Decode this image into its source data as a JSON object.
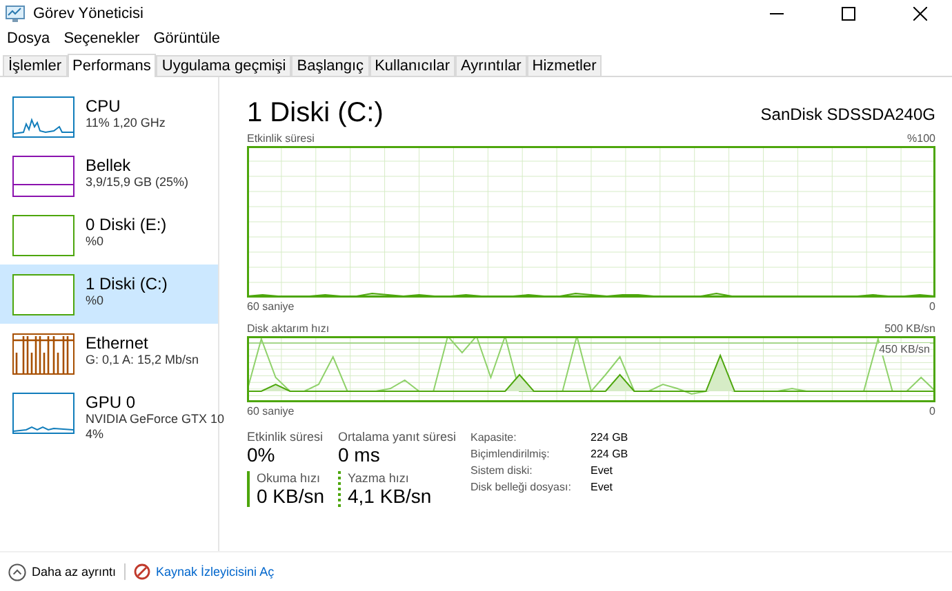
{
  "window": {
    "title": "Görev Yöneticisi"
  },
  "menu": [
    "Dosya",
    "Seçenekler",
    "Görüntüle"
  ],
  "tabs": [
    {
      "label": "İşlemler",
      "selected": false
    },
    {
      "label": "Performans",
      "selected": true
    },
    {
      "label": "Uygulama geçmişi",
      "selected": false
    },
    {
      "label": "Başlangıç",
      "selected": false
    },
    {
      "label": "Kullanıcılar",
      "selected": false
    },
    {
      "label": "Ayrıntılar",
      "selected": false
    },
    {
      "label": "Hizmetler",
      "selected": false
    }
  ],
  "sidebar": {
    "items": [
      {
        "kind": "cpu",
        "name": "CPU",
        "details": [
          "11% 1,20 GHz"
        ],
        "color": "#117dbb",
        "selected": false
      },
      {
        "kind": "memory",
        "name": "Bellek",
        "details": [
          "3,9/15,9 GB (25%)"
        ],
        "color": "#8b12ae",
        "selected": false
      },
      {
        "kind": "disk",
        "name": "0 Diski (E:)",
        "details": [
          "%0"
        ],
        "color": "#4da60c",
        "selected": false
      },
      {
        "kind": "disk",
        "name": "1 Diski (C:)",
        "details": [
          "%0"
        ],
        "color": "#4da60c",
        "selected": true
      },
      {
        "kind": "network",
        "name": "Ethernet",
        "details": [
          "G: 0,1 A: 15,2 Mb/sn"
        ],
        "color": "#a74f01",
        "selected": false
      },
      {
        "kind": "gpu",
        "name": "GPU 0",
        "details": [
          "NVIDIA GeForce GTX 10",
          "4%"
        ],
        "color": "#117dbb",
        "selected": false
      }
    ]
  },
  "detail": {
    "title": "1 Diski (C:)",
    "model": "SanDisk SDSSDA240G",
    "activity_chart": {
      "label": "Etkinlik süresi",
      "max": "%100",
      "time": "60 saniye",
      "min": "0"
    },
    "transfer_chart": {
      "label": "Disk aktarım hızı",
      "max": "500 KB/sn",
      "marker": "450 KB/sn",
      "time": "60 saniye",
      "min": "0"
    },
    "stats": [
      {
        "kind": "plain",
        "label": "Etkinlik süresi",
        "value": "0%"
      },
      {
        "kind": "plain",
        "label": "Ortalama yanıt süresi",
        "value": "0 ms"
      },
      {
        "kind": "read",
        "label": "Okuma hızı",
        "value": "0 KB/sn"
      },
      {
        "kind": "write",
        "label": "Yazma hızı",
        "value": "4,1 KB/sn"
      }
    ],
    "properties": [
      {
        "label": "Kapasite:",
        "value": "224 GB"
      },
      {
        "label": "Biçimlendirilmiş:",
        "value": "224 GB"
      },
      {
        "label": "Sistem diski:",
        "value": "Evet"
      },
      {
        "label": "Disk belleği dosyası:",
        "value": "Evet"
      }
    ]
  },
  "footer": {
    "fewer_details": "Daha az ayrıntı",
    "resource_monitor": "Kaynak İzleyicisini Aç"
  }
}
